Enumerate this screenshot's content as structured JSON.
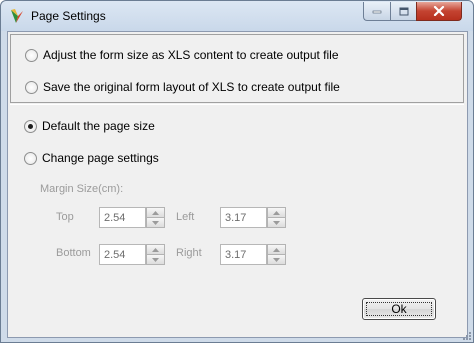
{
  "window": {
    "title": "Page Settings",
    "icon": "app-logo-icon",
    "controls": [
      "minimize-icon",
      "maximize-icon",
      "close-icon"
    ]
  },
  "layout_options": [
    {
      "label": "Adjust the form size as XLS content to create output file",
      "checked": false
    },
    {
      "label": "Save the original form layout of XLS to create output file",
      "checked": false
    }
  ],
  "page_options": [
    {
      "label": "Default the page size",
      "checked": true
    },
    {
      "label": "Change page settings",
      "checked": false
    }
  ],
  "margins": {
    "heading": "Margin Size(cm):",
    "top": {
      "label": "Top",
      "value": "2.54"
    },
    "left": {
      "label": "Left",
      "value": "3.17"
    },
    "bottom": {
      "label": "Bottom",
      "value": "2.54"
    },
    "right": {
      "label": "Right",
      "value": "3.17"
    },
    "enabled": false
  },
  "ok_button": {
    "label": "Ok"
  },
  "colors": {
    "frame": "#cfdbe9",
    "client": "#f0f0f0",
    "disabled_text": "#9b9b9b",
    "close_button": "#c44331"
  }
}
